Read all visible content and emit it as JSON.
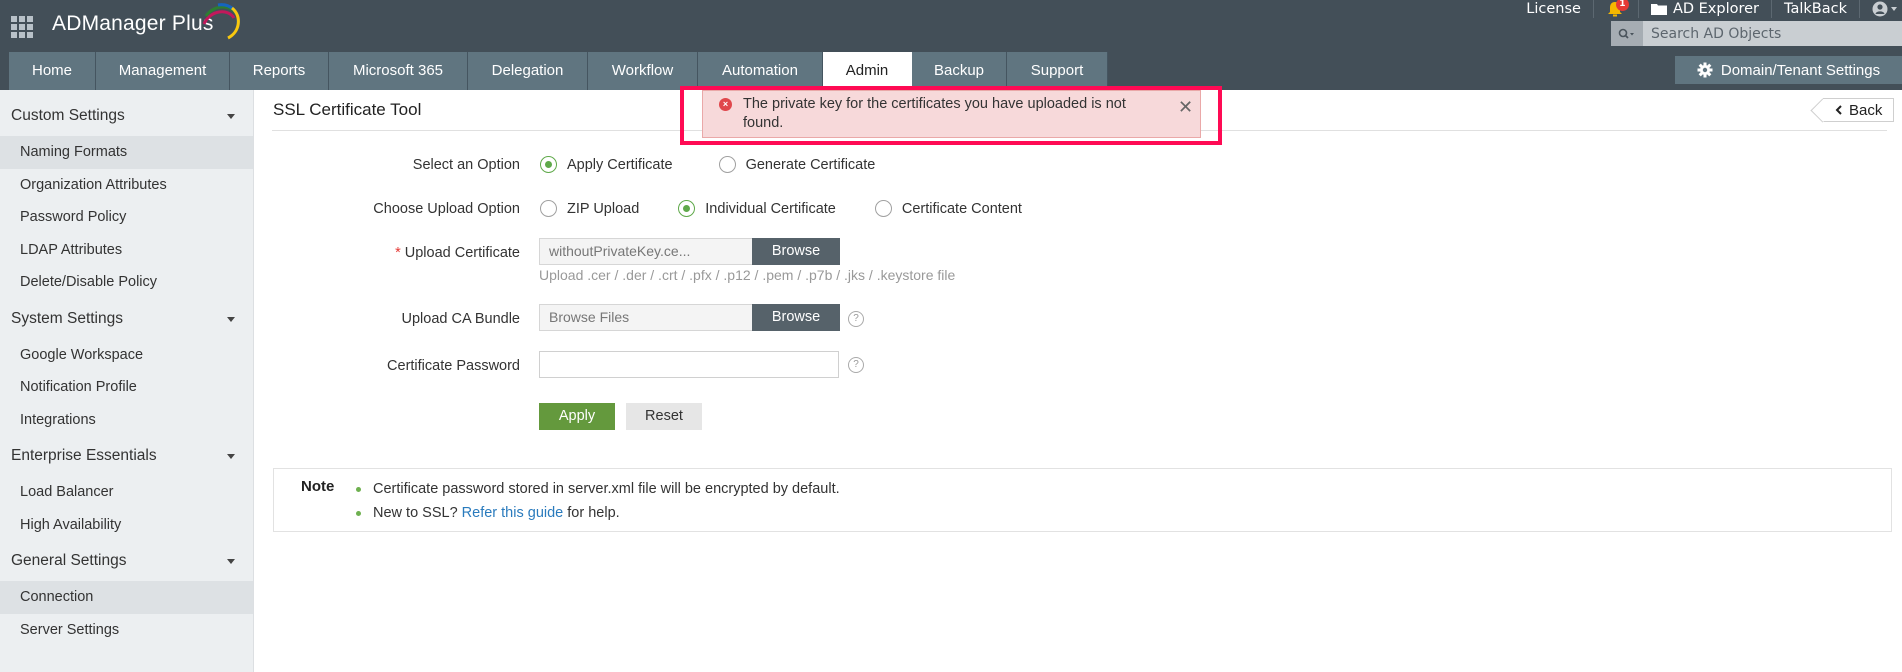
{
  "header": {
    "app_name": "ADManager Plus",
    "top_links": {
      "license": "License",
      "notifications_count": "1",
      "ad_explorer": "AD Explorer",
      "talkback": "TalkBack"
    },
    "search": {
      "placeholder": "Search AD Objects",
      "value": ""
    },
    "domain_settings_label": "Domain/Tenant Settings",
    "brand_colors": {
      "header_bg": "#434f58",
      "tab_bg": "#607580",
      "active_tab_bg": "#ffffff"
    }
  },
  "nav": {
    "tabs": [
      {
        "label": "Home",
        "active": false
      },
      {
        "label": "Management",
        "active": false
      },
      {
        "label": "Reports",
        "active": false
      },
      {
        "label": "Microsoft 365",
        "active": false
      },
      {
        "label": "Delegation",
        "active": false
      },
      {
        "label": "Workflow",
        "active": false
      },
      {
        "label": "Automation",
        "active": false
      },
      {
        "label": "Admin",
        "active": true
      },
      {
        "label": "Backup",
        "active": false
      },
      {
        "label": "Support",
        "active": false
      }
    ]
  },
  "sidebar": {
    "groups": [
      {
        "title": "Custom Settings",
        "items": [
          "Naming Formats",
          "Organization Attributes",
          "Password Policy",
          "LDAP Attributes",
          "Delete/Disable Policy"
        ],
        "selected": "Naming Formats"
      },
      {
        "title": "System Settings",
        "items": [
          "Google Workspace",
          "Notification Profile",
          "Integrations"
        ]
      },
      {
        "title": "Enterprise Essentials",
        "items": [
          "Load Balancer",
          "High Availability"
        ]
      },
      {
        "title": "General Settings",
        "items": [
          "Connection",
          "Server Settings"
        ],
        "selected": "Connection"
      }
    ]
  },
  "page": {
    "title": "SSL Certificate Tool",
    "back_label": "Back",
    "form": {
      "select_option": {
        "label": "Select an Option",
        "options": [
          "Apply Certificate",
          "Generate Certificate"
        ],
        "selected": "Apply Certificate"
      },
      "upload_option": {
        "label": "Choose Upload Option",
        "options": [
          "ZIP Upload",
          "Individual Certificate",
          "Certificate Content"
        ],
        "selected": "Individual Certificate"
      },
      "upload_certificate": {
        "required_mark": "*",
        "label": "Upload Certificate",
        "value": "withoutPrivateKey.ce...",
        "browse_label": "Browse",
        "hint": "Upload .cer / .der / .crt / .pfx / .p12 / .pem / .p7b / .jks / .keystore file"
      },
      "ca_bundle": {
        "label": "Upload CA Bundle",
        "placeholder": "Browse Files",
        "browse_label": "Browse",
        "help": "?"
      },
      "password": {
        "label": "Certificate Password",
        "value": "",
        "help": "?"
      },
      "apply_label": "Apply",
      "reset_label": "Reset"
    },
    "note": {
      "title": "Note",
      "line1": "Certificate password stored in server.xml file will be encrypted by default.",
      "line2_prefix": "New to SSL? ",
      "line2_link": "Refer this guide",
      "line2_suffix": " for help."
    }
  },
  "toast": {
    "type": "error",
    "message": "The private key for the certificates you have uploaded is not found.",
    "close_glyph": "✕",
    "icon_glyph": "×",
    "colors": {
      "bg": "#f7d9da",
      "icon": "#e0474c",
      "highlight": "#ff0a54"
    }
  }
}
